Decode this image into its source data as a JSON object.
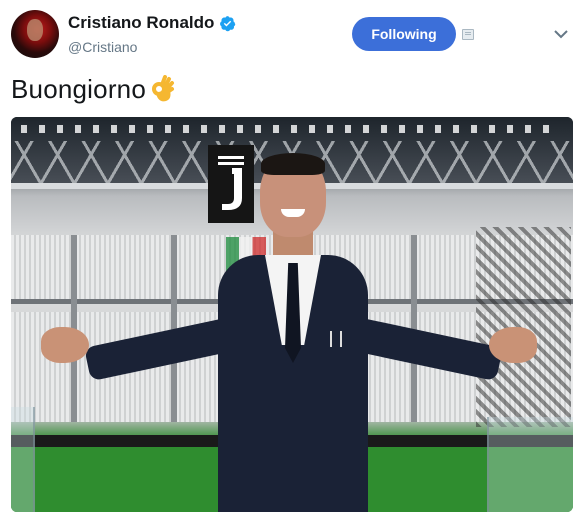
{
  "author": {
    "display_name": "Cristiano Ronaldo",
    "handle": "@Cristiano",
    "verified": true,
    "avatar_icon": "profile-avatar"
  },
  "follow_button": {
    "label": "Following"
  },
  "tweet": {
    "text": "Buongiorno",
    "emoji_icon": "ok-hand-icon"
  },
  "colors": {
    "accent": "#3c6fd9",
    "verified": "#1da1f2",
    "handle": "#657786"
  },
  "media": {
    "description_icon": "tweet-photo"
  }
}
